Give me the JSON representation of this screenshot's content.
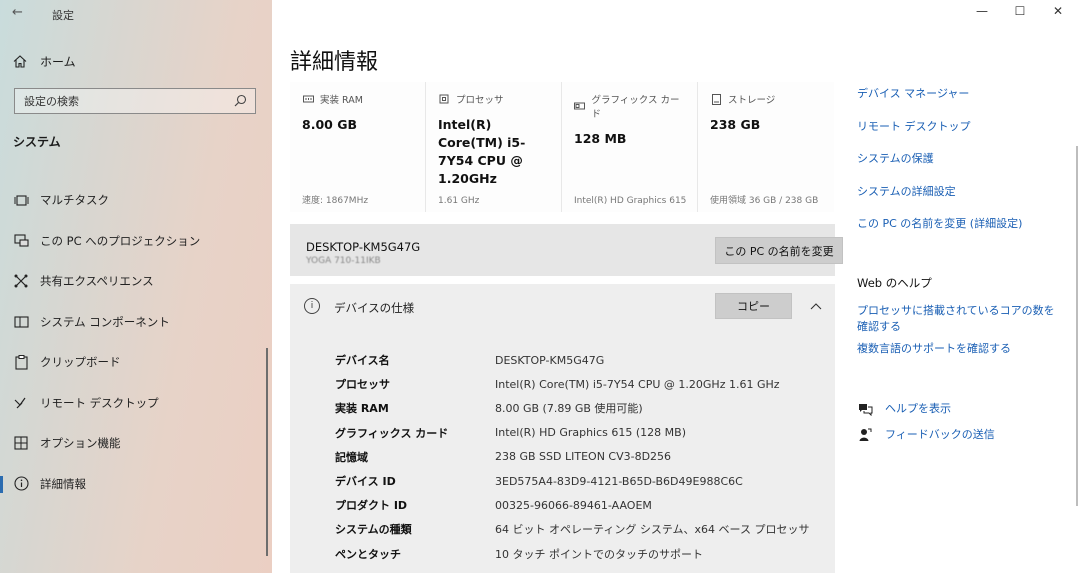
{
  "window": {
    "app_title": "設定",
    "minimize_icon": "minimize-icon",
    "maximize_icon": "maximize-icon",
    "close_icon": "close-icon"
  },
  "sidebar": {
    "home": "ホーム",
    "search_placeholder": "設定の検索",
    "section": "システム",
    "items": [
      {
        "label": "マルチタスク",
        "icon": "multitask-icon"
      },
      {
        "label": "この PC へのプロジェクション",
        "icon": "projection-icon"
      },
      {
        "label": "共有エクスペリエンス",
        "icon": "shared-experience-icon"
      },
      {
        "label": "システム コンポーネント",
        "icon": "system-components-icon"
      },
      {
        "label": "クリップボード",
        "icon": "clipboard-icon"
      },
      {
        "label": "リモート デスクトップ",
        "icon": "remote-desktop-icon"
      },
      {
        "label": "オプション機能",
        "icon": "optional-features-icon"
      },
      {
        "label": "詳細情報",
        "icon": "info-icon",
        "active": true
      }
    ]
  },
  "main": {
    "title": "詳細情報",
    "cards": [
      {
        "label": "実装 RAM",
        "value": "8.00 GB",
        "sub": "速度: 1867MHz",
        "icon": "ram-icon"
      },
      {
        "label": "プロセッサ",
        "value": "Intel(R) Core(TM) i5-7Y54 CPU @ 1.20GHz",
        "sub": "1.61 GHz",
        "icon": "processor-icon"
      },
      {
        "label": "グラフィックス カード",
        "value": "128 MB",
        "sub": "Intel(R) HD Graphics 615",
        "icon": "graphics-card-icon"
      },
      {
        "label": "ストレージ",
        "value": "238 GB",
        "sub": "使用領域 36 GB / 238 GB",
        "icon": "storage-icon"
      }
    ],
    "pc": {
      "name": "DESKTOP-KM5G47G",
      "model": "YOGA 710-11IKB",
      "rename_button": "この PC の名前を変更"
    },
    "spec": {
      "title": "デバイスの仕様",
      "copy_button": "コピー",
      "rows": [
        {
          "key": "デバイス名",
          "value": "DESKTOP-KM5G47G"
        },
        {
          "key": "プロセッサ",
          "value": "Intel(R) Core(TM) i5-7Y54 CPU @ 1.20GHz   1.61 GHz"
        },
        {
          "key": "実装 RAM",
          "value": "8.00 GB (7.89 GB 使用可能)"
        },
        {
          "key": "グラフィックス カード",
          "value": "Intel(R) HD Graphics 615 (128 MB)"
        },
        {
          "key": "記憶域",
          "value": "238 GB SSD LITEON CV3-8D256"
        },
        {
          "key": "デバイス ID",
          "value": "3ED575A4-83D9-4121-B65D-B6D49E988C6C"
        },
        {
          "key": "プロダクト ID",
          "value": "00325-96066-89461-AAOEM"
        },
        {
          "key": "システムの種類",
          "value": "64 ビット オペレーティング システム、x64 ベース プロセッサ"
        },
        {
          "key": "ペンとタッチ",
          "value": "10 タッチ ポイントでのタッチのサポート"
        }
      ]
    }
  },
  "related": {
    "links": [
      "デバイス マネージャー",
      "リモート デスクトップ",
      "システムの保護",
      "システムの詳細設定",
      "この PC の名前を変更 (詳細設定)"
    ],
    "help_title": "Web のヘルプ",
    "help_links": [
      "プロセッサに搭載されているコアの数を確認する",
      "複数言語のサポートを確認する"
    ],
    "show_help": "ヘルプを表示",
    "feedback": "フィードバックの送信"
  }
}
